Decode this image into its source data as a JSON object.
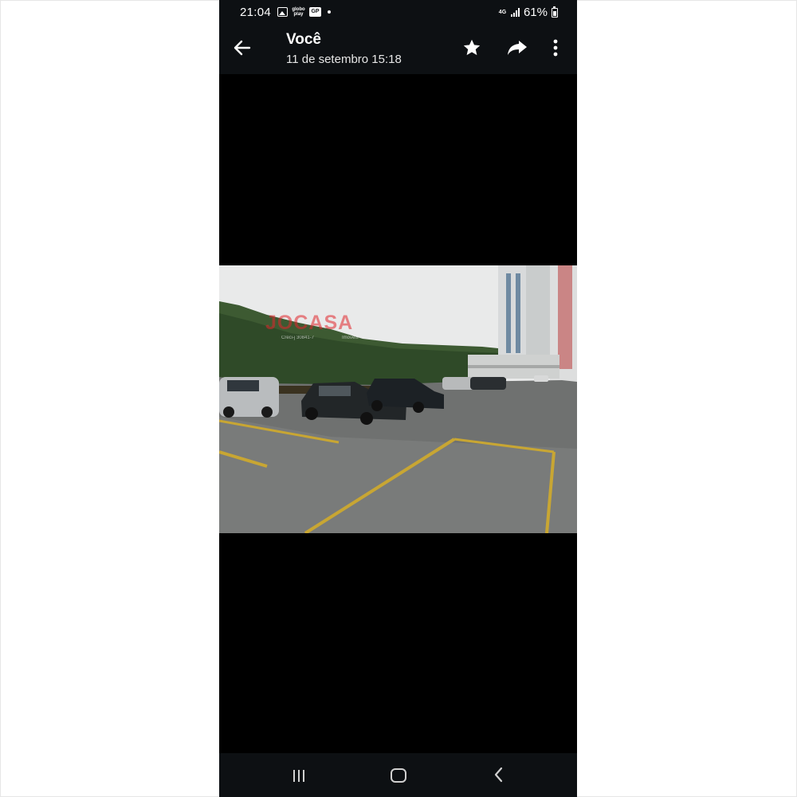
{
  "status_bar": {
    "time": "21:04",
    "left_icons": [
      "gallery-icon",
      "globoplay-icon",
      "app-notification-icon",
      "more-notifications-dot"
    ],
    "globoplay_text": "globo play",
    "app_badge_text": "GP",
    "network": "4G",
    "battery": "61%"
  },
  "app_bar": {
    "title": "Você",
    "subtitle": "11 de setembro 15:18",
    "back_icon": "arrow-left-icon",
    "actions": [
      "star-icon",
      "share-icon",
      "more-vertical-icon"
    ]
  },
  "photo": {
    "watermark": "JOCASA",
    "watermark_sub_left": "Creci-j 30841-7",
    "watermark_sub_right": "Imóveis"
  },
  "nav_bar": {
    "buttons": [
      "recent-apps-icon",
      "home-icon",
      "back-icon"
    ]
  },
  "colors": {
    "bar_background": "#0d1013",
    "viewer_background": "#000000",
    "text": "#ffffff",
    "watermark": "#e0272d"
  }
}
